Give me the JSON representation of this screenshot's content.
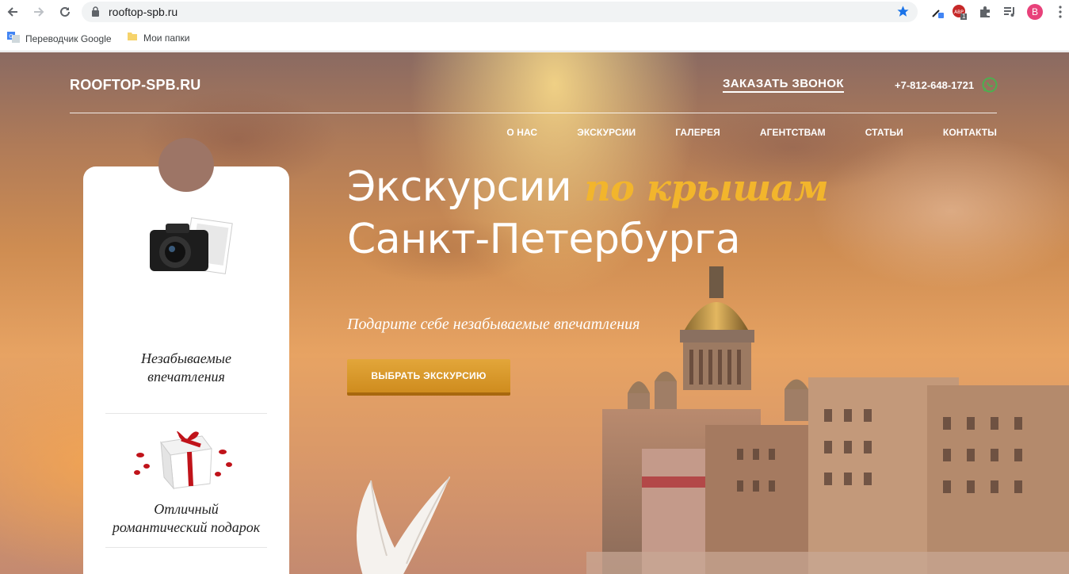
{
  "browser": {
    "url": "rooftop-spb.ru",
    "profile_initial": "B",
    "ext_badge": "1",
    "bookmarks": [
      {
        "label": "Переводчик Google",
        "icon": "google-translate-icon"
      },
      {
        "label": "Мои папки",
        "icon": "folder-icon"
      }
    ]
  },
  "site": {
    "logo": "ROOFTOP-SPB.RU",
    "callback": "ЗАКАЗАТЬ ЗВОНОК",
    "phone": "+7-812-648-1721",
    "menu": [
      "О НАС",
      "ЭКСКУРСИИ",
      "ГАЛЕРЕЯ",
      "АГЕНТСТВАМ",
      "СТАТЬИ",
      "КОНТАКТЫ"
    ],
    "headline_part1": "Экскурсии ",
    "headline_highlight": "по крышам",
    "headline_line2": "Санкт-Петербурга",
    "tagline": "Подарите себе незабываемые впечатления",
    "cta": "ВЫБРАТЬ ЭКСКУРСИЮ"
  },
  "features": [
    {
      "line1": "Незабываемые",
      "line2": "впечатления",
      "icon": "camera-icon"
    },
    {
      "line1": "Отличный",
      "line2": "романтический подарок",
      "icon": "gift-icon"
    },
    {
      "line1": "",
      "line2": "",
      "icon": "spyglass-icon"
    }
  ],
  "colors": {
    "accent_gold": "#f2b52c",
    "cta": "#d9962a",
    "bookmark_star": "#1a73e8"
  }
}
